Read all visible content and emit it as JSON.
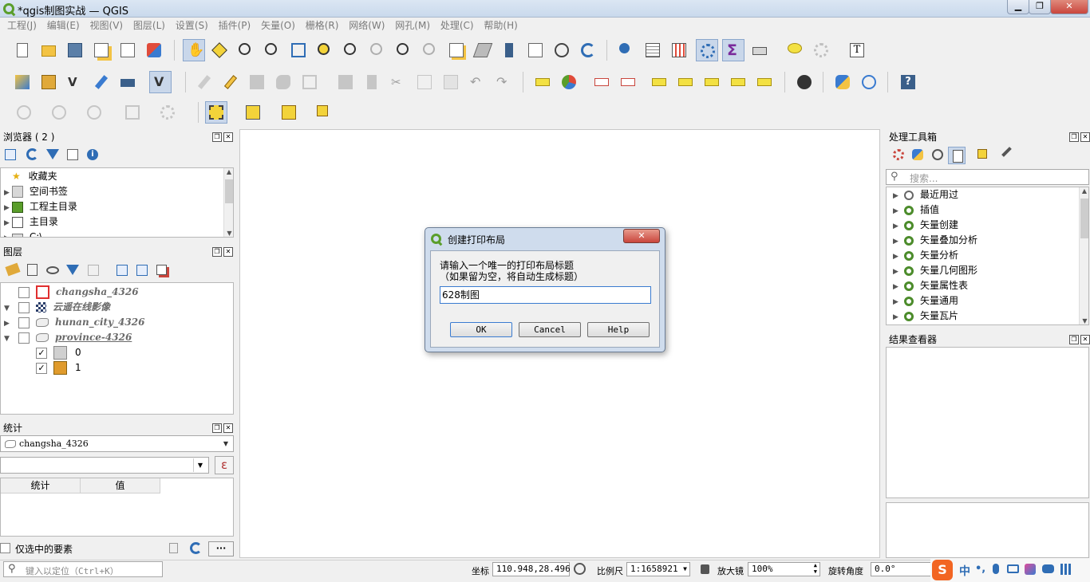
{
  "window": {
    "title": "*qgis制图实战 — QGIS",
    "min": "▁",
    "max": "❐",
    "close": "✕"
  },
  "menu": [
    "工程(J)",
    "编辑(E)",
    "视图(V)",
    "图层(L)",
    "设置(S)",
    "插件(P)",
    "矢量(O)",
    "栅格(R)",
    "网络(W)",
    "网孔(M)",
    "处理(C)",
    "帮助(H)"
  ],
  "browser": {
    "title": "浏览器 ( 2 )",
    "items": [
      {
        "label": "收藏夹",
        "icon": "star-icon"
      },
      {
        "label": "空间书签",
        "icon": "bookmark-icon"
      },
      {
        "label": "工程主目录",
        "icon": "project-home-icon"
      },
      {
        "label": "主目录",
        "icon": "home-icon"
      },
      {
        "label": "C:\\",
        "icon": "drive-icon"
      }
    ]
  },
  "layers": {
    "title": "图层",
    "items": [
      {
        "name": "changsha_4326",
        "expanded": false,
        "checked": false,
        "icon": "polygon-red-icon"
      },
      {
        "name": "云遥在线影像",
        "expanded": true,
        "checked": false,
        "icon": "raster-icon"
      },
      {
        "name": "hunan_city_4326",
        "expanded": false,
        "checked": false,
        "icon": "polygon-icon"
      },
      {
        "name": "province-4326",
        "expanded": true,
        "checked": false,
        "icon": "polygon-icon"
      }
    ],
    "legend": [
      {
        "label": "0",
        "color": "#d0d0d0",
        "checked": true
      },
      {
        "label": "1",
        "color": "#e09b2c",
        "checked": true
      }
    ]
  },
  "stats": {
    "title": "统计",
    "layer": "changsha_4326",
    "expr_symbol": "ε",
    "col_stat": "统计",
    "col_value": "值",
    "selected_only": "仅选中的要素",
    "more": "···"
  },
  "locator": {
    "placeholder": "键入以定位（Ctrl+K）"
  },
  "dialog": {
    "title": "创建打印布局",
    "prompt_line1": "请输入一个唯一的打印布局标题",
    "prompt_line2": "（如果留为空，将自动生成标题）",
    "value": "628制图",
    "ok": "OK",
    "cancel": "Cancel",
    "help": "Help"
  },
  "toolbox": {
    "title": "处理工具箱",
    "search_placeholder": "搜索...",
    "items": [
      "最近用过",
      "插值",
      "矢量创建",
      "矢量叠加分析",
      "矢量分析",
      "矢量几何图形",
      "矢量属性表",
      "矢量通用",
      "矢量瓦片"
    ]
  },
  "results": {
    "title": "结果查看器"
  },
  "status": {
    "coord_label": "坐标",
    "coord_value": "110.948,28.496",
    "scale_label": "比例尺",
    "scale_value": "1:1658921",
    "magnifier_label": "放大镜",
    "magnifier_value": "100%",
    "rotation_label": "旋转角度",
    "rotation_value": "0.0°"
  },
  "taskbar_ime": {
    "logo": "S",
    "lang": "中",
    "punct": "•,"
  },
  "colors": {
    "accent": "#2f6db5",
    "qgis_green": "#5a9e2b",
    "dialog_bg": "#e8edf4",
    "close_red": "#c9463d"
  }
}
